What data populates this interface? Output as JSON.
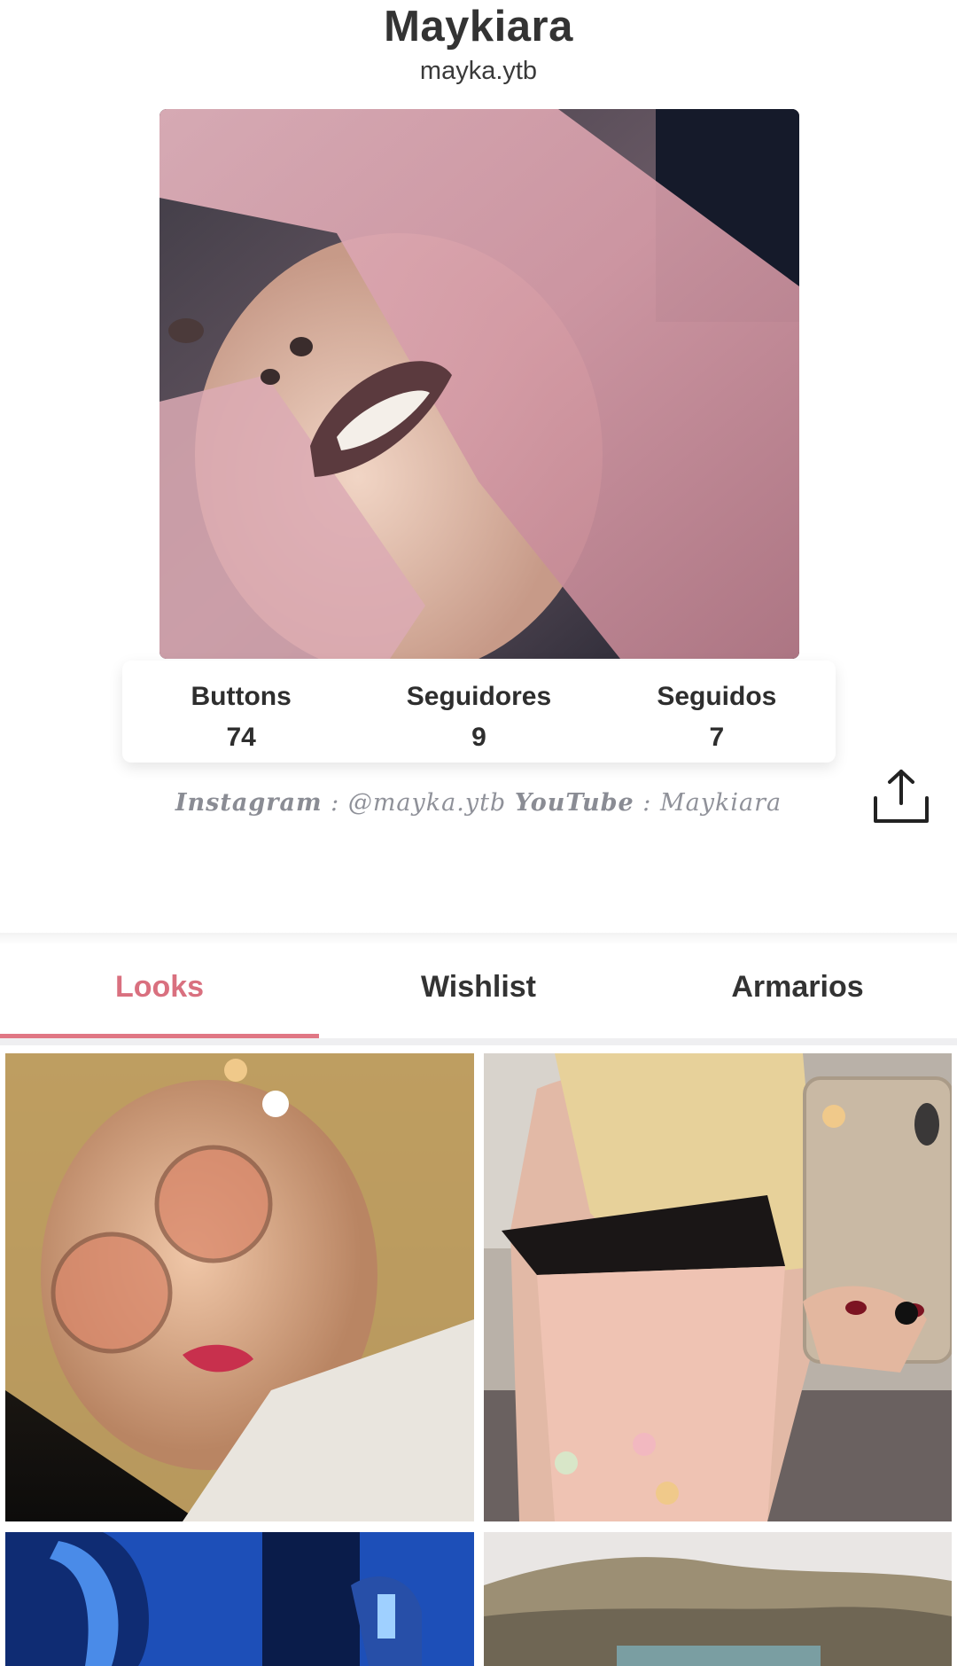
{
  "profile": {
    "name": "Maykiara",
    "handle": "mayka.ytb",
    "photo": "profile-photo-pink-hair"
  },
  "stats": [
    {
      "label": "Buttons",
      "value": "74"
    },
    {
      "label": "Seguidores",
      "value": "9"
    },
    {
      "label": "Seguidos",
      "value": "7"
    }
  ],
  "bio": {
    "instagram_label": "Instagram",
    "separator": ":",
    "instagram_handle": "@mayka.ytb",
    "youtube_label": "YouTube",
    "youtube_name": "Maykiara"
  },
  "share_icon": "share-icon",
  "tabs": [
    {
      "label": "Looks",
      "active": true
    },
    {
      "label": "Wishlist",
      "active": false
    },
    {
      "label": "Armarios",
      "active": false
    }
  ],
  "looks": [
    {
      "image": "sunglasses-selfie"
    },
    {
      "image": "mirror-selfie-pink-top"
    },
    {
      "image": "blue-lights"
    },
    {
      "image": "hills-landscape"
    }
  ],
  "colors": {
    "accent": "#e07784",
    "text": "#2e2e2e",
    "bio": "#8f9199"
  }
}
